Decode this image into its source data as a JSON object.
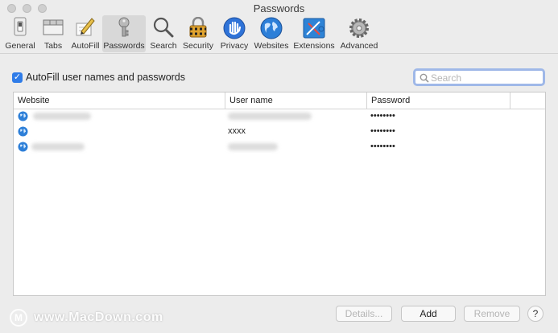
{
  "window": {
    "title": "Passwords"
  },
  "toolbar": {
    "items": [
      {
        "label": "General",
        "icon": "switch-icon"
      },
      {
        "label": "Tabs",
        "icon": "tabs-icon"
      },
      {
        "label": "AutoFill",
        "icon": "pencil-icon"
      },
      {
        "label": "Passwords",
        "icon": "key-icon",
        "selected": true
      },
      {
        "label": "Search",
        "icon": "magnifier-icon"
      },
      {
        "label": "Security",
        "icon": "padlock-icon"
      },
      {
        "label": "Privacy",
        "icon": "hand-icon"
      },
      {
        "label": "Websites",
        "icon": "globe-icon"
      },
      {
        "label": "Extensions",
        "icon": "puzzle-icon"
      },
      {
        "label": "Advanced",
        "icon": "gear-icon"
      }
    ]
  },
  "autofill": {
    "label": "AutoFill user names and passwords",
    "checked": true
  },
  "search": {
    "placeholder": "Search"
  },
  "table": {
    "columns": [
      "Website",
      "User name",
      "Password"
    ],
    "rows": [
      {
        "website": "",
        "username": "",
        "password": "••••••••"
      },
      {
        "website": "",
        "username": "xxxx",
        "password": "••••••••"
      },
      {
        "website": "",
        "username": "",
        "password": "••••••••"
      }
    ]
  },
  "buttons": {
    "details": "Details...",
    "add": "Add",
    "remove": "Remove",
    "help": "?"
  },
  "watermark": {
    "logo": "M",
    "text": "www.MacDown.com"
  },
  "colors": {
    "accent": "#2f7ce8",
    "focus_ring": "#9fb8e8"
  }
}
